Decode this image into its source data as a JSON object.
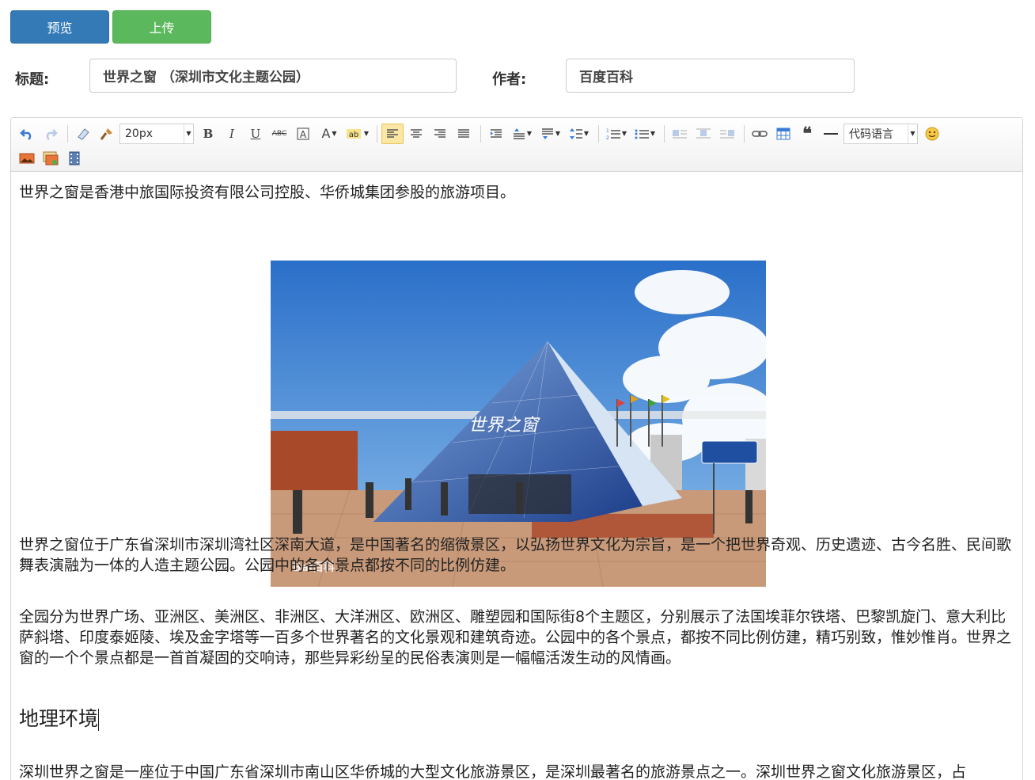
{
  "buttons": {
    "preview": "预览",
    "upload": "上传"
  },
  "form": {
    "title_label": "标题:",
    "title_value": "世界之窗 （深圳市文化主题公园）",
    "author_label": "作者:",
    "author_value": "百度百科"
  },
  "toolbar": {
    "font_size": "20px",
    "code_language": "代码语言",
    "bold": "B",
    "italic": "I",
    "underline": "U",
    "strike": "ABC",
    "font_color": "A"
  },
  "content": {
    "para0": "世界之窗是香港中旅国际投资有限公司控股、华侨城集团参股的旅游项目。",
    "image_watermark": "Bai百科",
    "para1": "世界之窗位于广东省深圳市深圳湾社区深南大道，是中国著名的缩微景区，以弘扬世界文化为宗旨，是一个把世界奇观、历史遗迹、古今名胜、民间歌舞表演融为一体的人造主题公园。公园中的各个景点都按不同的比例仿建。",
    "para2": "全园分为世界广场、亚洲区、美洲区、非洲区、大洋洲区、欧洲区、雕塑园和国际街8个主题区，分别展示了法国埃菲尔铁塔、巴黎凯旋门、意大利比萨斜塔、印度泰姬陵、埃及金字塔等一百多个世界著名的文化景观和建筑奇迹。公园中的各个景点，都按不同比例仿建，精巧别致，惟妙惟肖。世界之窗的一个个景点都是一首首凝固的交响诗，那些异彩纷呈的民俗表演则是一幅幅活泼生动的风情画。",
    "heading": "地理环境",
    "para3": "深圳世界之窗是一座位于中国广东省深圳市南山区华侨城的大型文化旅游景区，是深圳最著名的旅游景点之一。深圳世界之窗文化旅游景区，占"
  },
  "colors": {
    "preview_button": "#337ab7",
    "upload_button": "#5cb85c",
    "active_tool": "#fbe6a4"
  }
}
